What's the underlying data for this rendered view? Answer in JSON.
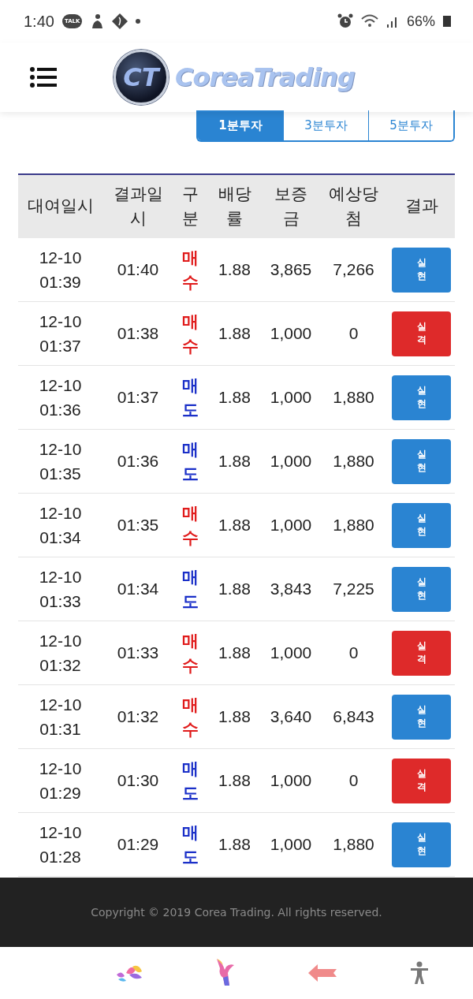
{
  "status_bar": {
    "time": "1:40",
    "chat_badge": "TALK",
    "battery": "66%"
  },
  "header": {
    "logo_mark": "CT",
    "brand": "CoreaTrading"
  },
  "tabs": [
    {
      "label": "1분투자",
      "selected": true
    },
    {
      "label": "3분투자",
      "selected": false
    },
    {
      "label": "5분투자",
      "selected": false
    }
  ],
  "table": {
    "columns": [
      "대여일시",
      "결과일시",
      "구분",
      "배당률",
      "보증금",
      "예상당첨",
      "결과"
    ],
    "rows": [
      {
        "rent_time": "12-10 01:39",
        "result_time": "01:40",
        "type": "매수",
        "color": "#e01b1b",
        "rate": "1.88",
        "deposit": "3,865",
        "expected": "7,266",
        "result": "실현",
        "kind": "win"
      },
      {
        "rent_time": "12-10 01:37",
        "result_time": "01:38",
        "type": "매수",
        "color": "#e01b1b",
        "rate": "1.88",
        "deposit": "1,000",
        "expected": "0",
        "result": "실격",
        "kind": "lose"
      },
      {
        "rent_time": "12-10 01:36",
        "result_time": "01:37",
        "type": "매도",
        "color": "#1a2fc8",
        "rate": "1.88",
        "deposit": "1,000",
        "expected": "1,880",
        "result": "실현",
        "kind": "win"
      },
      {
        "rent_time": "12-10 01:35",
        "result_time": "01:36",
        "type": "매도",
        "color": "#1a2fc8",
        "rate": "1.88",
        "deposit": "1,000",
        "expected": "1,880",
        "result": "실현",
        "kind": "win"
      },
      {
        "rent_time": "12-10 01:34",
        "result_time": "01:35",
        "type": "매수",
        "color": "#e01b1b",
        "rate": "1.88",
        "deposit": "1,000",
        "expected": "1,880",
        "result": "실현",
        "kind": "win"
      },
      {
        "rent_time": "12-10 01:33",
        "result_time": "01:34",
        "type": "매도",
        "color": "#1a2fc8",
        "rate": "1.88",
        "deposit": "3,843",
        "expected": "7,225",
        "result": "실현",
        "kind": "win"
      },
      {
        "rent_time": "12-10 01:32",
        "result_time": "01:33",
        "type": "매수",
        "color": "#e01b1b",
        "rate": "1.88",
        "deposit": "1,000",
        "expected": "0",
        "result": "실격",
        "kind": "lose"
      },
      {
        "rent_time": "12-10 01:31",
        "result_time": "01:32",
        "type": "매수",
        "color": "#e01b1b",
        "rate": "1.88",
        "deposit": "3,640",
        "expected": "6,843",
        "result": "실현",
        "kind": "win"
      },
      {
        "rent_time": "12-10 01:29",
        "result_time": "01:30",
        "type": "매도",
        "color": "#1a2fc8",
        "rate": "1.88",
        "deposit": "1,000",
        "expected": "0",
        "result": "실격",
        "kind": "lose"
      },
      {
        "rent_time": "12-10 01:28",
        "result_time": "01:29",
        "type": "매도",
        "color": "#1a2fc8",
        "rate": "1.88",
        "deposit": "1,000",
        "expected": "1,880",
        "result": "실현",
        "kind": "win"
      }
    ]
  },
  "footer": {
    "copyright": "Copyright © 2019 Corea Trading. All rights reserved."
  }
}
